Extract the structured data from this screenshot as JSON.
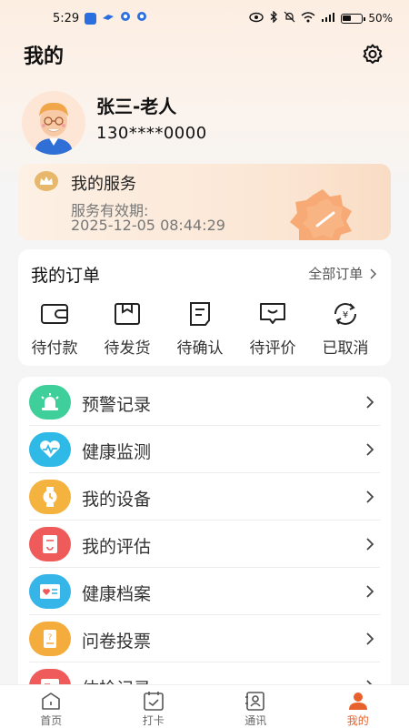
{
  "status_bar": {
    "time": "5:29",
    "battery_percent": "50%",
    "notification_icons": [
      "app-icon-blue",
      "bird-icon",
      "circle-icon",
      "circle-icon"
    ],
    "system_icons": [
      "eye-icon",
      "bluetooth-icon",
      "mute-icon",
      "wifi-icon",
      "signal-icon",
      "battery-icon"
    ]
  },
  "header": {
    "title": "我的"
  },
  "profile": {
    "name": "张三-老人",
    "phone": "130****0000"
  },
  "service": {
    "title": "我的服务",
    "validity_label": "服务有效期:",
    "validity_date": "2025-12-05 08:44:29"
  },
  "orders": {
    "title": "我的订单",
    "all_label": "全部订单",
    "items": [
      {
        "label": "待付款",
        "icon": "wallet-icon"
      },
      {
        "label": "待发货",
        "icon": "box-icon"
      },
      {
        "label": "待确认",
        "icon": "receipt-icon"
      },
      {
        "label": "待评价",
        "icon": "comment-icon"
      },
      {
        "label": "已取消",
        "icon": "refund-icon"
      }
    ]
  },
  "menu": {
    "items": [
      {
        "label": "预警记录",
        "icon": "alarm-icon",
        "color": "#3ecf9a"
      },
      {
        "label": "健康监测",
        "icon": "heartbeat-icon",
        "color": "#2fb9e6"
      },
      {
        "label": "我的设备",
        "icon": "watch-icon",
        "color": "#f4b23e"
      },
      {
        "label": "我的评估",
        "icon": "assessment-icon",
        "color": "#ef5b5b"
      },
      {
        "label": "健康档案",
        "icon": "health-card-icon",
        "color": "#36b6e8"
      },
      {
        "label": "问卷投票",
        "icon": "questionnaire-icon",
        "color": "#f4ac3c"
      },
      {
        "label": "体检记录",
        "icon": "checkup-icon",
        "color": "#ef5b5b"
      }
    ]
  },
  "bottom_nav": {
    "items": [
      {
        "label": "首页",
        "icon": "home-icon"
      },
      {
        "label": "打卡",
        "icon": "calendar-check-icon"
      },
      {
        "label": "通讯",
        "icon": "contacts-icon"
      },
      {
        "label": "我的",
        "icon": "profile-icon"
      }
    ],
    "active": "我的",
    "active_color": "#e8612c"
  }
}
